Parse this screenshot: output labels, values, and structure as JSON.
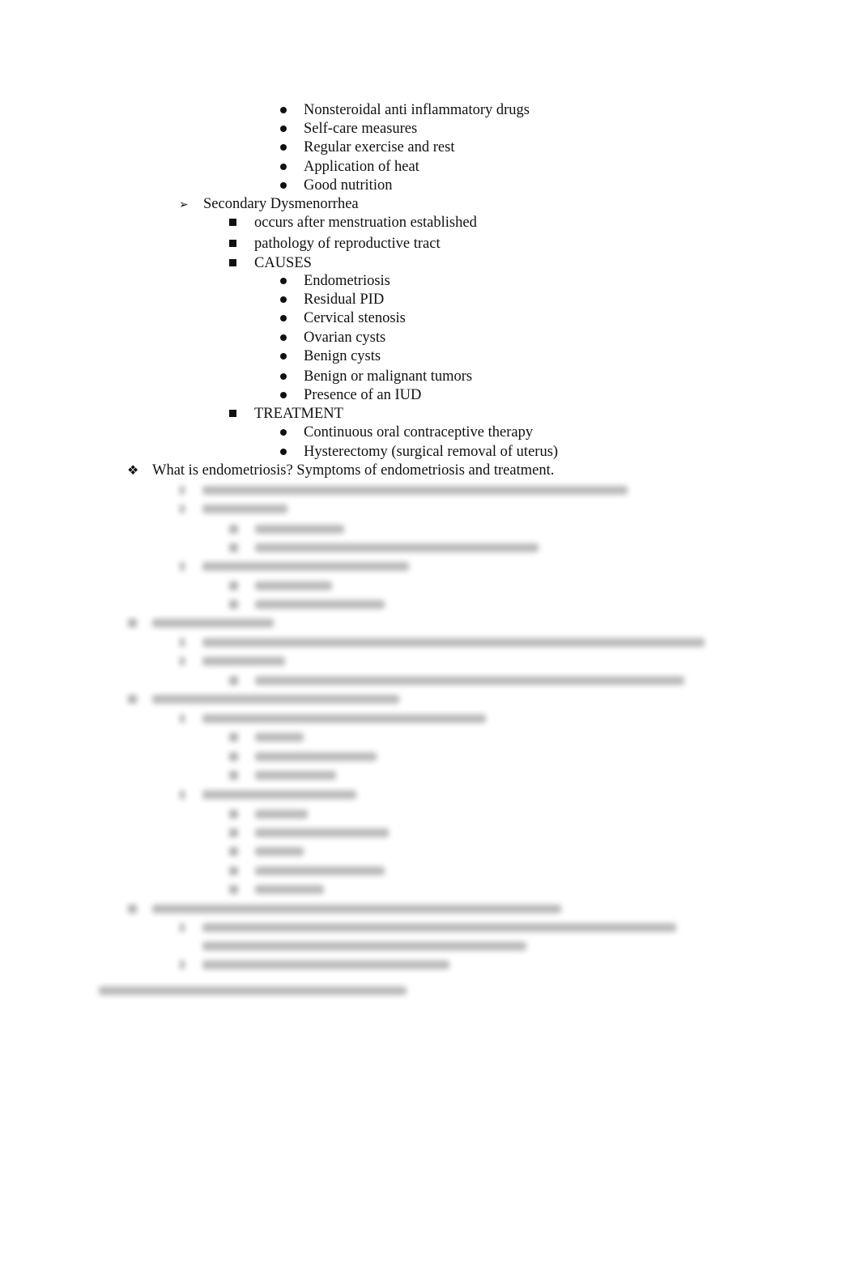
{
  "document": {
    "lines": [
      {
        "level": 3,
        "bullet": "dot",
        "text": "Nonsteroidal anti inflammatory drugs"
      },
      {
        "level": 3,
        "bullet": "dot",
        "text": "Self-care measures"
      },
      {
        "level": 3,
        "bullet": "dot",
        "text": "Regular exercise and rest"
      },
      {
        "level": 3,
        "bullet": "dot",
        "text": "Application of heat"
      },
      {
        "level": 3,
        "bullet": "dot",
        "text": "Good nutrition"
      },
      {
        "level": 1,
        "bullet": "arrow",
        "text": "Secondary Dysmenorrhea"
      },
      {
        "level": 2,
        "bullet": "square",
        "text": "occurs after menstruation established"
      },
      {
        "level": 2,
        "bullet": "square",
        "text": "pathology of reproductive tract"
      },
      {
        "level": 2,
        "bullet": "square",
        "text": "CAUSES"
      },
      {
        "level": 3,
        "bullet": "dot",
        "text": "Endometriosis"
      },
      {
        "level": 3,
        "bullet": "dot",
        "text": "Residual PID"
      },
      {
        "level": 3,
        "bullet": "dot",
        "text": "Cervical stenosis"
      },
      {
        "level": 3,
        "bullet": "dot",
        "text": "Ovarian cysts"
      },
      {
        "level": 3,
        "bullet": "dot",
        "text": "Benign cysts"
      },
      {
        "level": 3,
        "bullet": "dot",
        "text": "Benign or malignant tumors"
      },
      {
        "level": 3,
        "bullet": "dot",
        "text": "Presence of an IUD"
      },
      {
        "level": 2,
        "bullet": "square",
        "text": "TREATMENT"
      },
      {
        "level": 3,
        "bullet": "dot",
        "text": "Continuous oral contraceptive therapy"
      },
      {
        "level": 3,
        "bullet": "dot",
        "text": "Hysterectomy (surgical removal of uterus)"
      },
      {
        "level": 0,
        "bullet": "diamond",
        "text": "What is endometriosis? Symptoms of endometriosis and treatment."
      }
    ],
    "bullet_glyphs": {
      "arrow": "➢",
      "diamond": "❖"
    },
    "blurred_notice": "remaining content obscured"
  }
}
